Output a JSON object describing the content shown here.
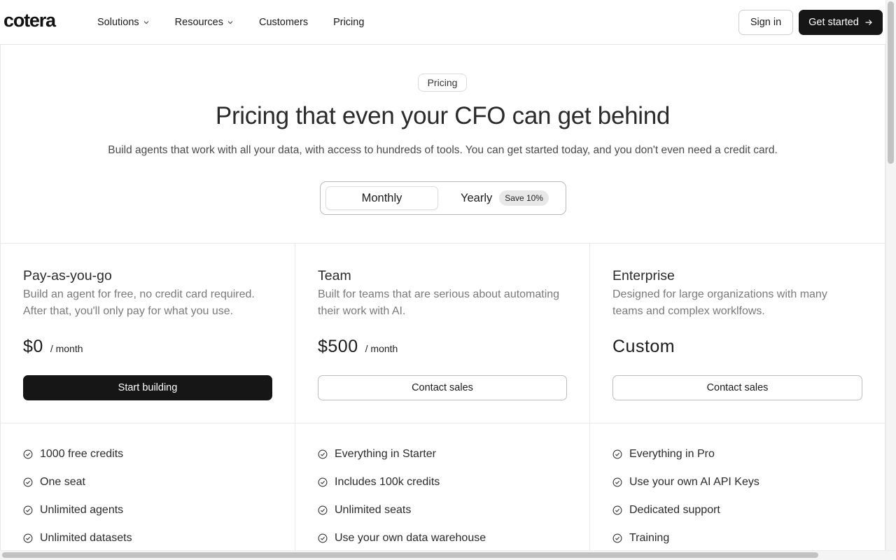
{
  "header": {
    "logo": "cotera",
    "nav": [
      {
        "label": "Solutions",
        "has_dropdown": true
      },
      {
        "label": "Resources",
        "has_dropdown": true
      },
      {
        "label": "Customers",
        "has_dropdown": false
      },
      {
        "label": "Pricing",
        "has_dropdown": false
      }
    ],
    "sign_in": "Sign in",
    "get_started": "Get started"
  },
  "hero": {
    "badge": "Pricing",
    "title": "Pricing that even your CFO can get behind",
    "subtitle": "Build agents that work with all your data, with access to hundreds of tools. You can get started today, and you don't even need a credit card."
  },
  "billing_toggle": {
    "monthly": "Monthly",
    "yearly": "Yearly",
    "yearly_badge": "Save 10%",
    "selected": "Monthly"
  },
  "plans": [
    {
      "name": "Pay-as-you-go",
      "description": "Build an agent for free, no credit card required. After that, you'll only pay for what you use.",
      "price": "$0",
      "unit": "/ month",
      "cta": "Start building",
      "features": [
        "1000 free credits",
        "One seat",
        "Unlimited agents",
        "Unlimited datasets"
      ]
    },
    {
      "name": "Team",
      "description": "Built for teams that are serious about automating their work with AI.",
      "price": "$500",
      "unit": "/ month",
      "cta": "Contact sales",
      "features": [
        "Everything in Starter",
        "Includes 100k credits",
        "Unlimited seats",
        "Use your own data warehouse"
      ]
    },
    {
      "name": "Enterprise",
      "description": "Designed for large organizations with many teams and complex worklfows.",
      "price": "Custom",
      "unit": "",
      "cta": "Contact sales",
      "features": [
        "Everything in Pro",
        "Use your own AI API Keys",
        "Dedicated support",
        "Training"
      ]
    }
  ],
  "colors": {
    "primary_button": "#161616",
    "border": "#e6e6e6",
    "muted_text": "#7a7a7a"
  }
}
